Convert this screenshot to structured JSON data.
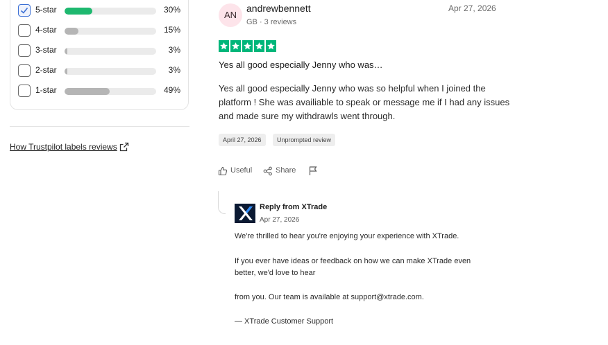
{
  "rating_filter": {
    "rows": [
      {
        "label": "5-star",
        "percent_text": "30%",
        "fraction": 0.3,
        "checked": true
      },
      {
        "label": "4-star",
        "percent_text": "15%",
        "fraction": 0.15,
        "checked": false
      },
      {
        "label": "3-star",
        "percent_text": "3%",
        "fraction": 0.03,
        "checked": false
      },
      {
        "label": "2-star",
        "percent_text": "3%",
        "fraction": 0.03,
        "checked": false
      },
      {
        "label": "1-star",
        "percent_text": "49%",
        "fraction": 0.49,
        "checked": false
      }
    ],
    "labels_link": "How Trustpilot labels reviews"
  },
  "review": {
    "initials": "AN",
    "name": "andrewbennett",
    "meta": "GB · 3 reviews",
    "date_top": "Apr 27, 2026",
    "stars": 5,
    "title": "Yes all good especially Jenny who was…",
    "body": "Yes all good especially Jenny who was so helpful when I joined the platform ! She was availiable to speak or message me if I had any issues and made sure my withdrawls went through.",
    "tags": [
      "April 27, 2026",
      "Unprompted review"
    ],
    "actions": {
      "useful": "Useful",
      "share": "Share"
    }
  },
  "reply": {
    "from": "Reply from XTrade",
    "date": "Apr 27, 2026",
    "paragraphs": [
      "We're thrilled to hear you're enjoying your experience with XTrade.",
      "If you ever have ideas or feedback on how we can make XTrade even better, we'd love to hear",
      "from you. Our team is available at support@xtrade.com.",
      "— XTrade Customer Support"
    ]
  },
  "colors": {
    "star_green": "#00b67a",
    "bar_active": "#1eb86f",
    "avatar_bg": "#fde4ea",
    "logo_bg": "#0b1a33"
  }
}
